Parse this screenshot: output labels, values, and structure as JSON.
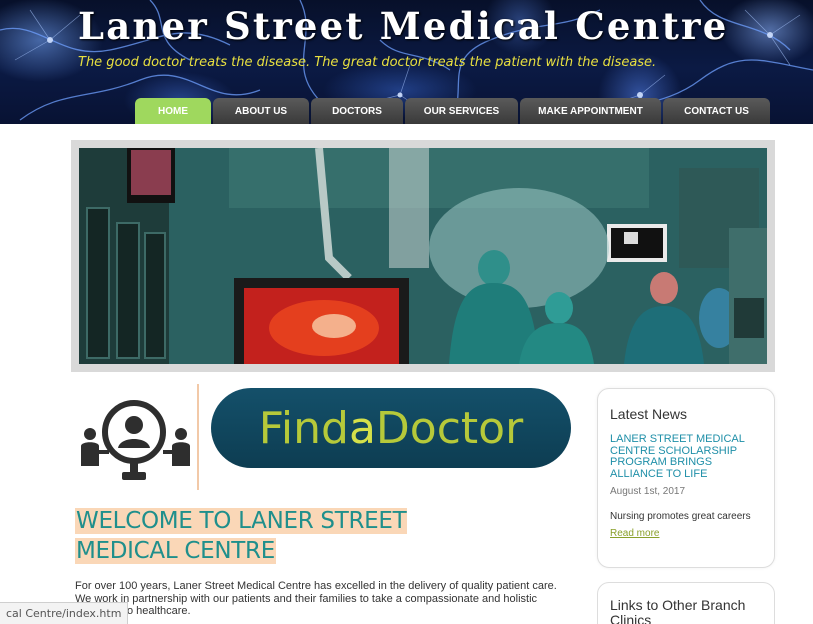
{
  "header": {
    "site_title": "Laner Street Medical Centre",
    "tagline": "The good doctor treats the disease. The great doctor treats the patient with the disease."
  },
  "nav": {
    "items": [
      {
        "label": "HOME",
        "active": true
      },
      {
        "label": "ABOUT US",
        "active": false
      },
      {
        "label": "DOCTORS",
        "active": false
      },
      {
        "label": "OUR SERVICES",
        "active": false
      },
      {
        "label": "MAKE APPOINTMENT",
        "active": false
      },
      {
        "label": "CONTACT US",
        "active": false
      }
    ]
  },
  "hero": {
    "icon": "operating-room-photo"
  },
  "find_doctor": {
    "icon": "doctor-network-icon",
    "label_prefix": "Find",
    "label_mid": "a",
    "label_suffix": "Doctor"
  },
  "welcome": {
    "heading": "WELCOME TO LANER STREET MEDICAL CENTRE",
    "intro": "For over 100 years, Laner Street Medical Centre has excelled in the delivery of quality patient care. We work in partnership with our patients and their families to take a compassionate and holistic approach to healthcare."
  },
  "sidebar": {
    "news": {
      "title": "Latest News",
      "headline": "LANER STREET MEDICAL CENTRE SCHOLARSHIP PROGRAM BRINGS ALLIANCE TO LIFE",
      "date": "August 1st, 2017",
      "snippet": "Nursing promotes great careers",
      "read_more": "Read more"
    },
    "links": {
      "title": "Links to Other Branch Clinics"
    }
  },
  "status_bar": {
    "url": "cal Centre/index.htm"
  },
  "colors": {
    "nav_active": "#9fd85e",
    "welcome_text": "#1f8f8c",
    "welcome_highlight": "#fad7b7",
    "news_link": "#1f8fa8",
    "read_more": "#8aa02b",
    "tagline": "#e8e040"
  }
}
